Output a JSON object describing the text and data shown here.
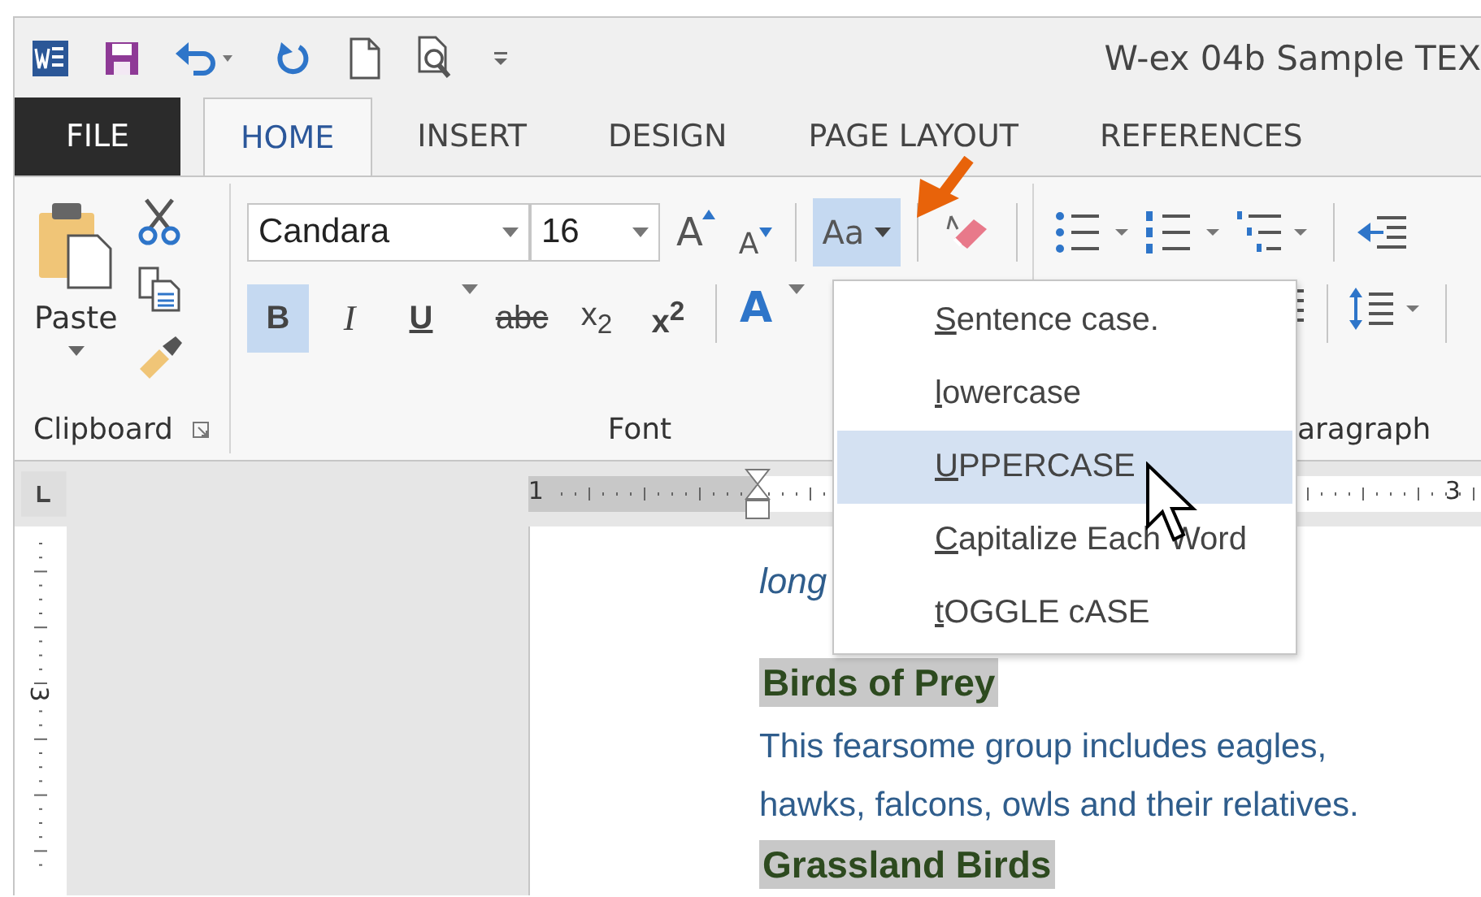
{
  "window": {
    "title": "W-ex 04b Sample TEX"
  },
  "tabs": [
    {
      "label": "FILE",
      "kind": "file",
      "selected": false
    },
    {
      "label": "HOME",
      "kind": "tab",
      "selected": true
    },
    {
      "label": "INSERT",
      "kind": "tab",
      "selected": false
    },
    {
      "label": "DESIGN",
      "kind": "tab",
      "selected": false
    },
    {
      "label": "PAGE LAYOUT",
      "kind": "tab",
      "selected": false
    },
    {
      "label": "REFERENCES",
      "kind": "tab",
      "selected": false
    }
  ],
  "ribbon": {
    "clipboard": {
      "paste_label": "Paste",
      "group_label": "Clipboard"
    },
    "font": {
      "font_name": "Candara",
      "font_size": "16",
      "grow_label": "A",
      "shrink_label": "A",
      "change_case_label": "Aa",
      "change_case_open": true,
      "format_buttons": [
        {
          "label": "B",
          "kind": "bold",
          "selected": true
        },
        {
          "label": "I",
          "kind": "italic",
          "selected": false
        },
        {
          "label": "U",
          "kind": "underline",
          "selected": false
        },
        {
          "label": "abc",
          "kind": "strike",
          "selected": false
        },
        {
          "label": "x$_{2}$",
          "kind": "plain",
          "selected": false
        },
        {
          "label": "x$^{2}$",
          "kind": "plain",
          "selected": false
        }
      ],
      "effects_label": "A",
      "group_label": "Font"
    },
    "paragraph": {
      "group_label": "aragraph"
    }
  },
  "ruler": {
    "labels": [
      "1",
      "3"
    ],
    "vertical_label": "3"
  },
  "change_case_menu": [
    {
      "label": "Sentence case.",
      "selected": false
    },
    {
      "label": "lowercase",
      "selected": false
    },
    {
      "label": "UPPERCASE",
      "selected": true
    },
    {
      "label": "Capitalize Each Word",
      "selected": false
    },
    {
      "label": "tOGGLE cASE",
      "selected": false
    }
  ],
  "document": [
    {
      "kind": "italic",
      "text": "long"
    },
    {
      "kind": "heading",
      "text": "Birds of Prey"
    },
    {
      "kind": "body",
      "text": "This fearsome group includes eagles, hawks, falcons, owls and their relatives."
    },
    {
      "kind": "heading",
      "text": "Grassland Birds"
    }
  ]
}
